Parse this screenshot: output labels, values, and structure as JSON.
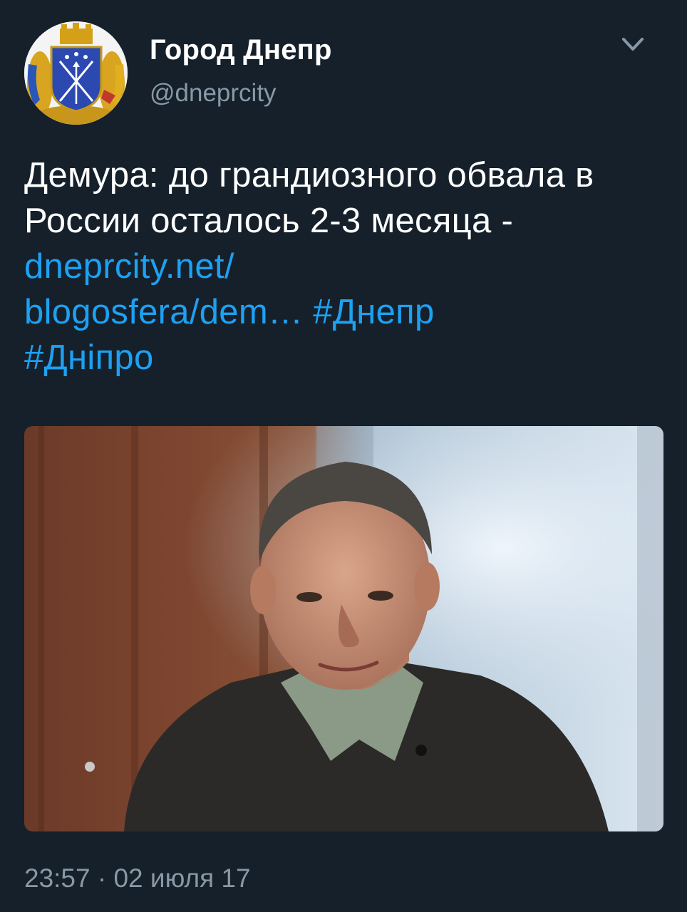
{
  "author": {
    "display_name": "Город Днепр",
    "handle": "@dneprcity",
    "avatar_icon": "city-coat-of-arms-icon"
  },
  "menu": {
    "icon": "chevron-down-icon"
  },
  "tweet": {
    "text": "Демура: до грандиозного обвала в России осталось 2-3 месяца - ",
    "link_line1": "dneprcity.net/",
    "link_line2": "blogosfera/dem…",
    "hashtag1": "#Днепр",
    "hashtag2": "#Дніпро"
  },
  "media": {
    "type": "photo"
  },
  "meta": {
    "timestamp": "23:57 · 02 июля 17"
  },
  "colors": {
    "background": "#15202b",
    "link": "#1da1f2",
    "secondary_text": "#8899a6"
  }
}
